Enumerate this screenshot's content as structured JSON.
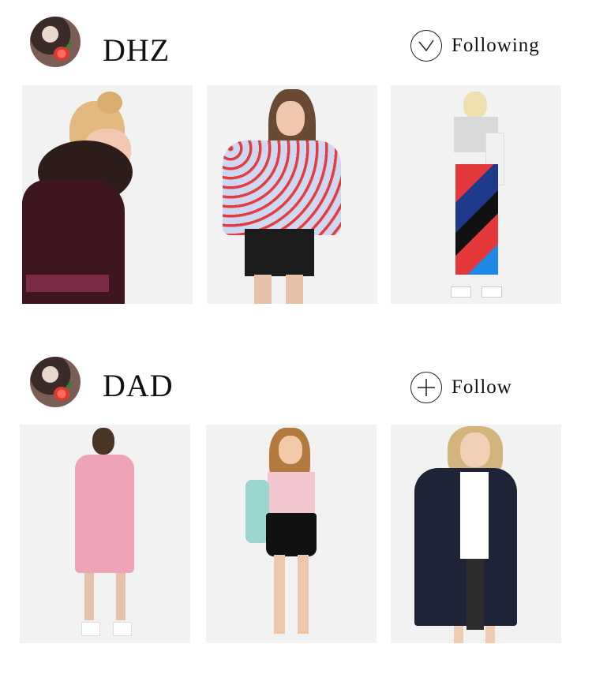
{
  "users": [
    {
      "name": "DHZ",
      "follow_label": "Following",
      "follow_icon": "check-icon",
      "photos": [
        {
          "name": "photo-knit-sweater-fur-collar"
        },
        {
          "name": "photo-printed-shirt-leather-skirt"
        },
        {
          "name": "photo-crop-top-patterned-trousers"
        }
      ]
    },
    {
      "name": "DAD",
      "follow_label": "Follow",
      "follow_icon": "plus-icon",
      "photos": [
        {
          "name": "photo-pink-dress"
        },
        {
          "name": "photo-floral-top-black-skirt"
        },
        {
          "name": "photo-navy-coat"
        }
      ]
    }
  ],
  "colors": {
    "background": "#ffffff",
    "text": "#111111",
    "photo_bg": "#f3f2f2"
  }
}
